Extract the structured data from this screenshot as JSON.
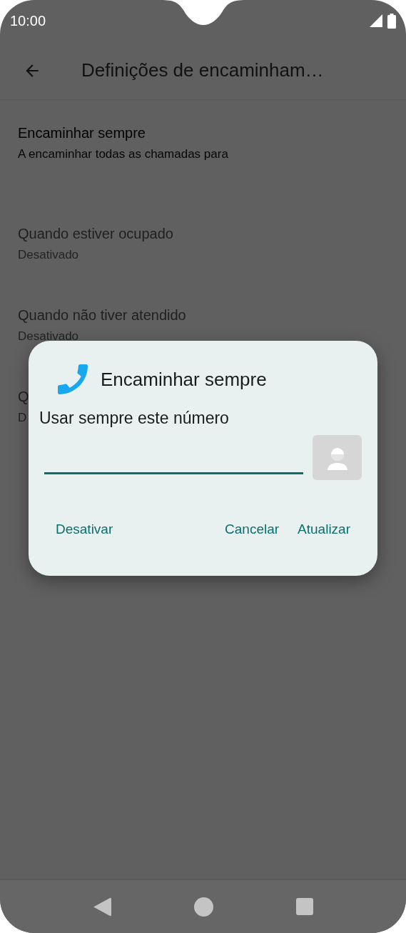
{
  "status_bar": {
    "time": "10:00"
  },
  "app_bar": {
    "title": "Definições de encaminham…"
  },
  "settings": [
    {
      "title": "Encaminhar sempre",
      "subtitle": "A encaminhar todas as chamadas para",
      "disabled": false
    },
    {
      "title": "Quando estiver ocupado",
      "subtitle": "Desativado",
      "disabled": true
    },
    {
      "title": "Quando não tiver atendido",
      "subtitle": "Desativado",
      "disabled": true
    },
    {
      "title": "Q",
      "subtitle": "D",
      "disabled": true
    }
  ],
  "dialog": {
    "title": "Encaminhar sempre",
    "label": "Usar sempre este número",
    "field": {
      "focused": true
    },
    "buttons": [
      "Desativar",
      "Cancelar",
      "Atualizar"
    ]
  }
}
